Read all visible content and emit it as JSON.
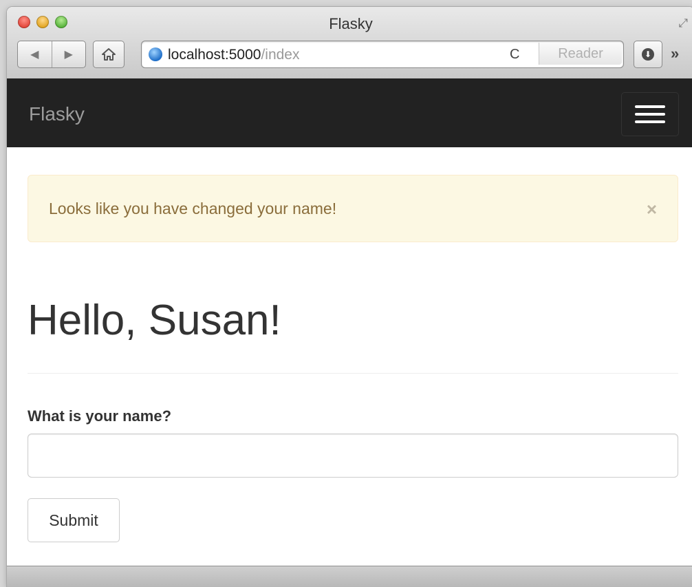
{
  "window": {
    "title": "Flasky",
    "fullscreen_icon": "fullscreen-arrows-icon"
  },
  "toolbar": {
    "back_glyph": "◀",
    "forward_glyph": "▶",
    "home_icon": "home-icon",
    "url_host": "localhost:5000",
    "url_path": "/index",
    "reload_glyph": "C",
    "reader_label": "Reader",
    "download_glyph": "⬇",
    "overflow_glyph": "»"
  },
  "navbar": {
    "brand": "Flasky",
    "toggle_icon": "hamburger-menu-icon"
  },
  "alert": {
    "message": "Looks like you have changed your name!",
    "close_glyph": "×",
    "colors": {
      "background": "#fcf8e3",
      "border": "#faebcc",
      "text": "#8a6d3b"
    }
  },
  "page": {
    "heading": "Hello, Susan!"
  },
  "form": {
    "name_label": "What is your name?",
    "name_value": "",
    "submit_label": "Submit"
  },
  "colors": {
    "navbar_bg": "#222222",
    "brand_text": "#9d9d9d"
  }
}
